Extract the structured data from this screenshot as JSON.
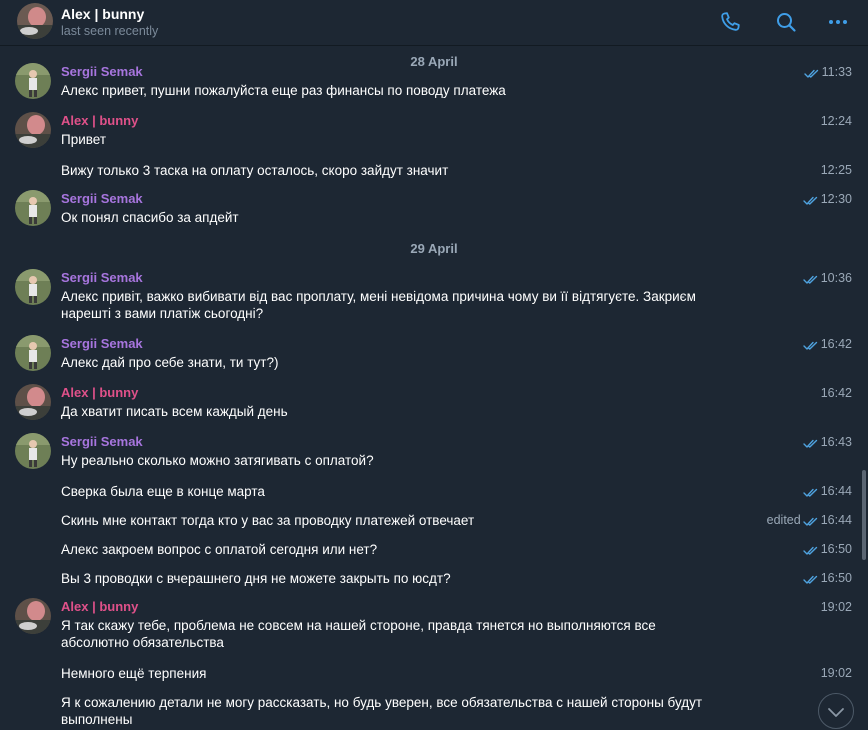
{
  "header": {
    "title": "Alex | bunny",
    "subtitle": "last seen recently",
    "icons": [
      "phone-icon",
      "search-icon",
      "more-icon"
    ]
  },
  "colors": {
    "background": "#1d2733",
    "sergii_name": "#a775de",
    "alex_name": "#e0518a",
    "check_blue": "#4fa3e0",
    "muted": "#9aa8b7"
  },
  "dates": [
    "28 April",
    "29 April"
  ],
  "messages": [
    {
      "sender": "Sergii Semak",
      "text": "Алекс привет, пушни пожалуйста еще раз финансы по поводу платежа",
      "time": "11:33",
      "read": true
    },
    {
      "sender": "Alex | bunny",
      "text": "Привет",
      "time": "12:24"
    },
    {
      "text": "Вижу только 3 таска на оплату осталось, скоро зайдут значит",
      "time": "12:25"
    },
    {
      "sender": "Sergii Semak",
      "text": "Ок понял спасибо за апдейт",
      "time": "12:30",
      "read": true
    },
    {
      "sender": "Sergii Semak",
      "text": "Алекс привіт, важко вибивати від вас проплату, мені невідома причина чому ви її відтягуєте. Закриєм нарешті з вами платіж сьогодні?",
      "time": "10:36",
      "read": true
    },
    {
      "sender": "Sergii Semak",
      "text": "Алекс дай про себе знати, ти тут?)",
      "time": "16:42",
      "read": true
    },
    {
      "sender": "Alex | bunny",
      "text": "Да хватит писать всем каждый день",
      "time": "16:42"
    },
    {
      "sender": "Sergii Semak",
      "text": "Ну реально сколько можно затягивать с оплатой?",
      "time": "16:43",
      "read": true
    },
    {
      "text": "Сверка была еще в конце марта",
      "time": "16:44",
      "read": true
    },
    {
      "text": "Скинь мне контакт тогда кто у вас за проводку платежей отвечает",
      "time": "16:44",
      "edited": "edited",
      "read": true
    },
    {
      "text": "Алекс закроем вопрос с оплатой сегодня или нет?",
      "time": "16:50",
      "read": true
    },
    {
      "text": "Вы 3 проводки с вчерашнего дня не можете закрыть по юсдт?",
      "time": "16:50",
      "read": true
    },
    {
      "sender": "Alex | bunny",
      "text": "Я так скажу тебе, проблема не совсем на нашей стороне, правда тянется но выполняются все абсолютно обязательства",
      "time": "19:02"
    },
    {
      "text": "Немного ещё терпения",
      "time": "19:02"
    },
    {
      "text": "Я к сожалению детали не могу рассказать, но будь уверен, все обязательства с нашей стороны будут выполнены",
      "time": ""
    }
  ]
}
